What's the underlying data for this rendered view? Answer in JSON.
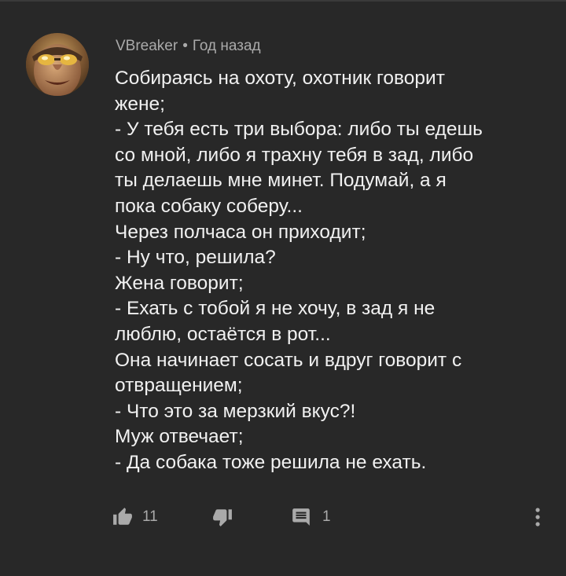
{
  "comment": {
    "author": "VBreaker",
    "separator": "•",
    "time": "Год назад",
    "lines": [
      "Собираясь на охоту, охотник говорит",
      "жене;",
      "- У тебя есть три выбора: либо ты едешь",
      "со мной, либо я трахну тебя в зад, либо",
      "ты делаешь мне минет. Подумай, а я",
      "пока собаку соберу...",
      "Через полчаса он приходит;",
      "- Ну что, решила?",
      "Жена говорит;",
      "- Ехать с тобой я не хочу, в зад я не",
      "люблю, остаётся в рот...",
      "Она начинает сосать и вдруг говорит с",
      "отвращением;",
      "- Что это за мерзкий вкус?!",
      "Муж отвечает;",
      "- Да собака тоже решила не ехать."
    ]
  },
  "actions": {
    "like_count": "11",
    "reply_count": "1",
    "icons": {
      "like": "thumbs-up-icon",
      "dislike": "thumbs-down-icon",
      "reply": "comment-icon",
      "more": "more-vertical-icon"
    }
  },
  "colors": {
    "background": "#282828",
    "text": "#f1f1f1",
    "secondary_text": "#aaaaaa"
  }
}
